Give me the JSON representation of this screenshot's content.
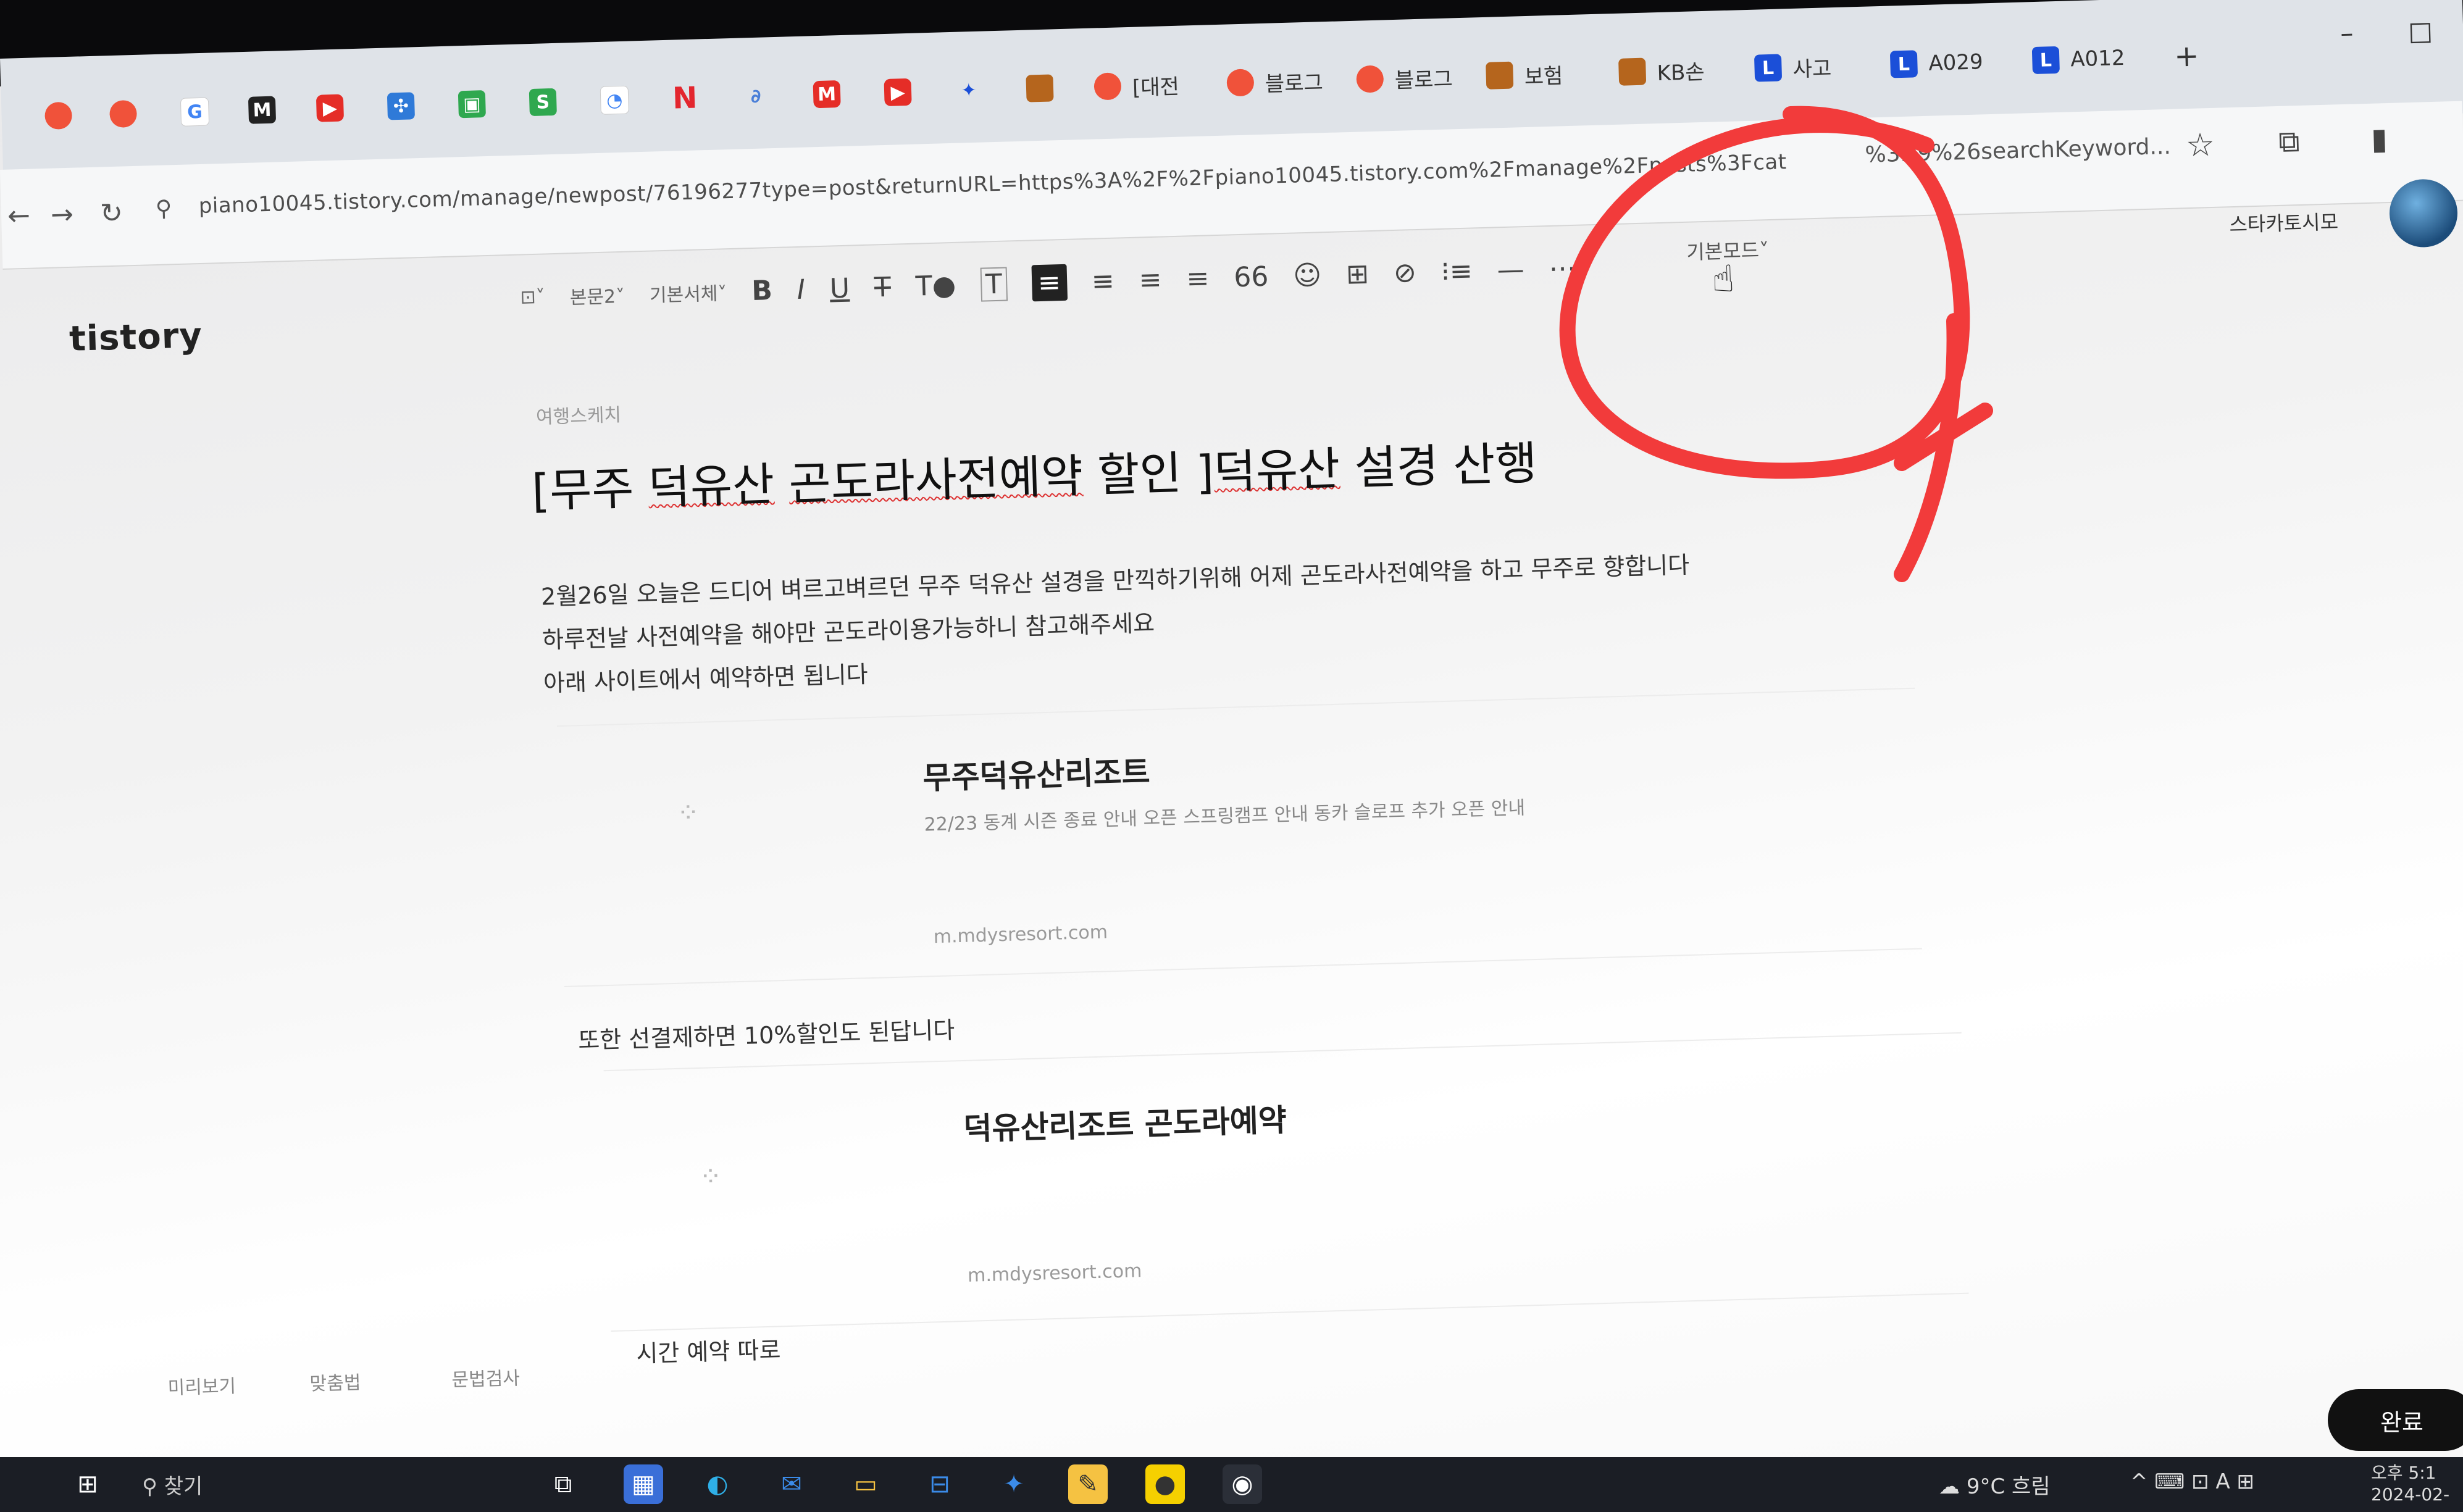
{
  "browser": {
    "tabs": [
      {
        "label": "",
        "icon": "tistory-icon"
      },
      {
        "label": "",
        "icon": "tistory-icon"
      },
      {
        "label": "G",
        "icon": "google-icon"
      },
      {
        "label": "M",
        "icon": "m-icon"
      },
      {
        "label": "",
        "icon": "youtube-icon"
      },
      {
        "label": "",
        "icon": "grid-icon"
      },
      {
        "label": "",
        "icon": "green-icon"
      },
      {
        "label": "",
        "icon": "s-icon"
      },
      {
        "label": "",
        "icon": "o-icon"
      },
      {
        "label": "N",
        "icon": "n-icon"
      },
      {
        "label": "",
        "icon": "link-icon"
      },
      {
        "label": "",
        "icon": "m-red-icon"
      },
      {
        "label": "",
        "icon": "youtube-icon"
      },
      {
        "label": "",
        "icon": "bird-icon"
      },
      {
        "label": "",
        "icon": "k-icon"
      },
      {
        "label": "[대전",
        "icon": "tistory-icon"
      },
      {
        "label": "블로그",
        "icon": "tistory-icon"
      },
      {
        "label": "블로그",
        "icon": "tistory-icon"
      },
      {
        "label": "보험",
        "icon": "k-icon"
      },
      {
        "label": "KB손",
        "icon": "k-icon"
      },
      {
        "label": "사고",
        "icon": "l-icon"
      },
      {
        "label": "A029",
        "icon": "l-icon"
      },
      {
        "label": "A012",
        "icon": "l-icon"
      }
    ],
    "new_tab": "+",
    "url": "piano10045.tistory.com/manage/newpost/76196277type=post&returnURL=https%3A%2F%2Fpiano10045.tistory.com%2Fmanage%2Fposts%3Fcat",
    "url_tail": "%3D9%26searchKeyword..."
  },
  "editor": {
    "logo": "tistory",
    "toolbar": {
      "image": "⊡˅",
      "style": "본문2˅",
      "font": "기본서체˅",
      "bold": "B",
      "italic": "I",
      "underline": "U",
      "strike": "T",
      "color": "T●",
      "bg": "T",
      "align_left": "≡",
      "align_center": "≡",
      "align_right": "≡",
      "align_justify": "≡",
      "quote": "66",
      "emoji": "☺",
      "table": "⊞",
      "link": "⊘",
      "list": "⁝≡",
      "hr": "—",
      "more": "⋯",
      "mode": "기본모드˅"
    },
    "profile_name": "스타카토시모",
    "category": "여행스케치",
    "title_prefix": "[무주 ",
    "title_spell1": "덕유산",
    "title_mid1": " ",
    "title_spell2": "곤도라사전예약",
    "title_mid2": " 할인 ]",
    "title_spell3": "덕유산",
    "title_suffix": " 설경 산행",
    "paragraphs": [
      "2월26일 오늘은 드디어 벼르고벼르던 무주 덕유산 설경을 만끽하기위해 어제 곤도라사전예약을 하고 무주로 향합니다",
      "하루전날 사전예약을 해야만 곤도라이용가능하니 참고해주세요",
      "아래 사이트에서 예약하면 됩니다"
    ],
    "card1": {
      "title": "무주덕유산리조트",
      "desc": "22/23 동계 시즌 종료 안내 오픈 스프링캠프 안내 동카 슬로프 추가 오픈 안내",
      "url": "m.mdysresort.com"
    },
    "middle_text": "또한 선결제하면 10%할인도 된답니다",
    "card2": {
      "title": "덕유산리조트 곤도라예약",
      "url": "m.mdysresort.com"
    },
    "last_text": "시간 예약 따로",
    "bottom_tools": [
      "미리보기",
      "맞춤법",
      "문법검사"
    ],
    "done_button": "완료"
  },
  "taskbar": {
    "search": "찾기",
    "weather": "9°C 흐림",
    "time": "오후 5:1",
    "date": "2024-02-"
  },
  "colors": {
    "markup_red": "#f23b3b",
    "tistory_orange": "#f0523a",
    "taskbar": "#1b1e25"
  }
}
